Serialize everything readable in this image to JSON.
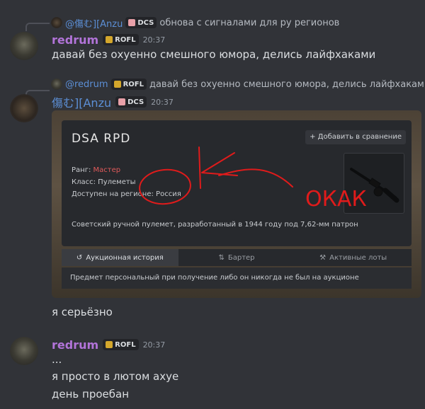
{
  "messages": [
    {
      "reply": {
        "author": "@傷む][Anzu",
        "tag": "DCS",
        "text": "обнова с сигналами для ру регионов"
      },
      "author": "redrum",
      "tag": "ROFL",
      "time": "20:37",
      "text": "давай без охуенно смешного юмора, делись лайфхаками"
    },
    {
      "reply": {
        "author": "@redrum",
        "tag": "ROFL",
        "text": "давай без охуенно смешного юмора, делись лайфхаками"
      },
      "author": "傷む][Anzu",
      "tag": "DCS",
      "time": "20:37",
      "after_text": "я серьёзно"
    },
    {
      "author": "redrum",
      "tag": "ROFL",
      "time": "20:37",
      "lines": [
        "...",
        "я просто в лютом ахуе",
        "день проебан"
      ]
    }
  ],
  "embed": {
    "title": "DSA RPD",
    "compare_button": "+ Добавить в сравнение",
    "rank_label": "Ранг:",
    "rank_value": "Мастер",
    "class_label": "Класс:",
    "class_value": "Пулеметы",
    "region_label": "Доступен на регионе:",
    "region_value": "Россия",
    "description": "Советский ручной пулемет, разработанный в 1944 году под 7,62-мм патрон",
    "tabs": [
      "Аукционная история",
      "Бартер",
      "Активные лоты"
    ],
    "tab_message": "Предмет персональный при получение либо он никогда не был на аукционе",
    "annotation_text": "ОКАК"
  },
  "colors": {
    "background": "#313338",
    "redrum": "#b274d9",
    "anzu": "#5c8fd6",
    "annotation": "#e01b1b"
  }
}
